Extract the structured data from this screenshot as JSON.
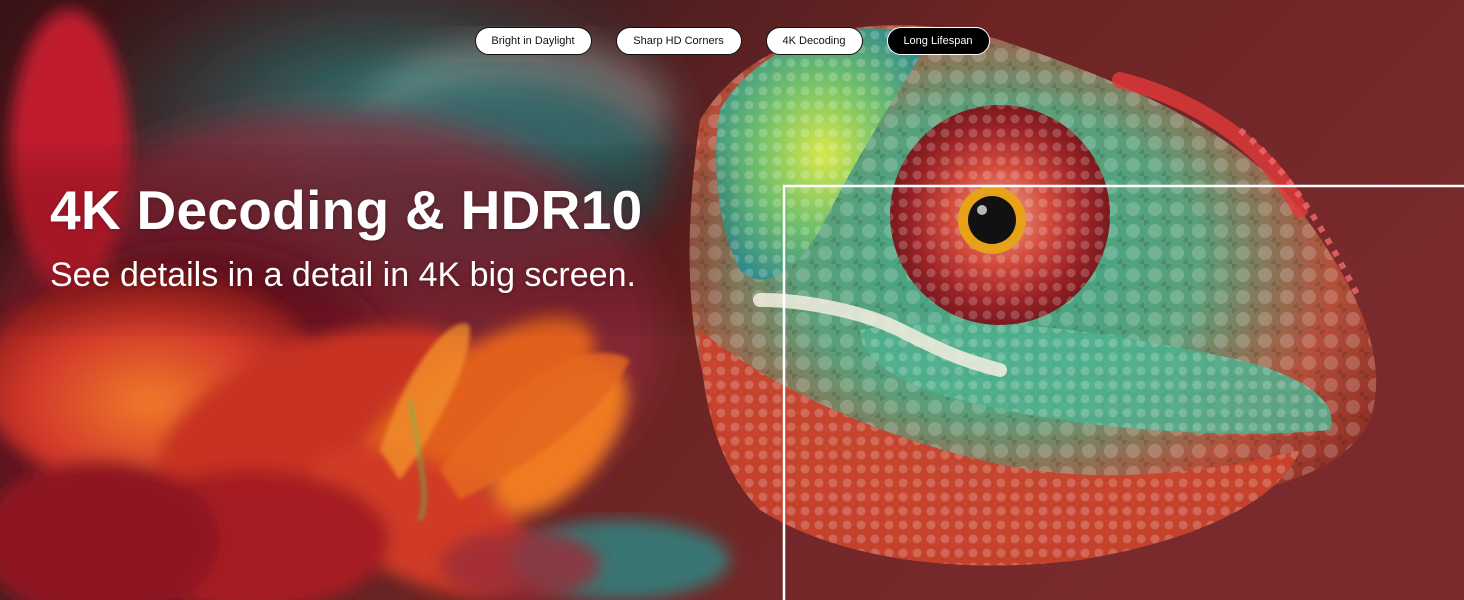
{
  "tabs": [
    {
      "label": "Bright in Daylight",
      "active": false
    },
    {
      "label": "Sharp HD Corners",
      "active": false
    },
    {
      "label": "4K Decoding",
      "active": false
    },
    {
      "label": "Long Lifespan",
      "active": true
    }
  ],
  "hero": {
    "title": "4K Decoding & HDR10",
    "subtitle": "See details in a detail in 4K big screen."
  },
  "colors": {
    "tab_background": "#ffffff",
    "tab_text": "#111111",
    "active_tab_background": "#000000",
    "active_tab_text": "#ffffff",
    "headline_text": "#ffffff",
    "frame_line": "#ffffff"
  },
  "icons": {
    "hero_image": "chameleon-closeup-photo"
  }
}
